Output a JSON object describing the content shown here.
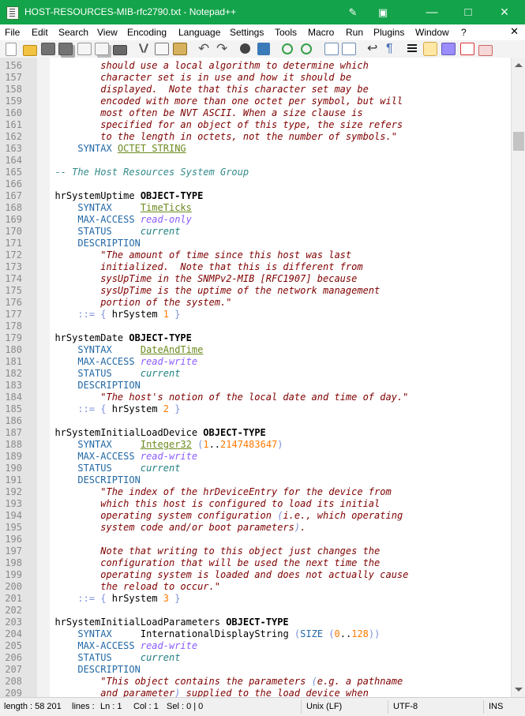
{
  "window": {
    "title": "HOST-RESOURCES-MIB-rfc2790.txt - Notepad++"
  },
  "menu": [
    "File",
    "Edit",
    "Search",
    "View",
    "Encoding",
    "Language",
    "Settings",
    "Tools",
    "Macro",
    "Run",
    "Plugins",
    "Window",
    "?"
  ],
  "toolbar": {
    "icons": [
      "new-file-icon",
      "open-file-icon",
      "save-icon",
      "save-all-icon",
      "close-icon",
      "close-all-icon",
      "print-icon",
      "cut-icon",
      "copy-icon",
      "paste-icon",
      "undo-icon",
      "redo-icon",
      "find-icon",
      "replace-icon",
      "zoom-in-icon",
      "zoom-out-icon",
      "sync-vertical-icon",
      "sync-horizontal-icon",
      "word-wrap-icon",
      "show-symbols-icon",
      "indent-guide-icon",
      "document-map-icon",
      "function-list-icon",
      "folder-as-workspace-icon",
      "monitor-icon",
      "record-macro-icon",
      "play-macro-icon"
    ]
  },
  "editor": {
    "lines": [
      {
        "n": "156",
        "t": "          should use a local algorithm to determine which"
      },
      {
        "n": "157",
        "t": "          character set is in use and how it should be"
      },
      {
        "n": "158",
        "t": "          displayed.  Note that this character set may be"
      },
      {
        "n": "159",
        "t": "          encoded with more than one octet per symbol, but will"
      },
      {
        "n": "160",
        "t": "          most often be NVT ASCII. When a size clause is"
      },
      {
        "n": "161",
        "t": "          specified for an object of this type, the size refers"
      },
      {
        "n": "162",
        "t": "          to the length in octets, not the number of symbols.\""
      },
      {
        "n": "163",
        "t": "      SYNTAX OCTET STRING"
      },
      {
        "n": "164",
        "t": ""
      },
      {
        "n": "165",
        "t": "  -- The Host Resources System Group"
      },
      {
        "n": "166",
        "t": ""
      },
      {
        "n": "167",
        "t": "  hrSystemUptime OBJECT-TYPE"
      },
      {
        "n": "168",
        "t": "      SYNTAX     TimeTicks"
      },
      {
        "n": "169",
        "t": "      MAX-ACCESS read-only"
      },
      {
        "n": "170",
        "t": "      STATUS     current"
      },
      {
        "n": "171",
        "t": "      DESCRIPTION"
      },
      {
        "n": "172",
        "t": "          \"The amount of time since this host was last"
      },
      {
        "n": "173",
        "t": "          initialized.  Note that this is different from"
      },
      {
        "n": "174",
        "t": "          sysUpTime in the SNMPv2-MIB [RFC1907] because"
      },
      {
        "n": "175",
        "t": "          sysUpTime is the uptime of the network management"
      },
      {
        "n": "176",
        "t": "          portion of the system.\""
      },
      {
        "n": "177",
        "t": "      ::= { hrSystem 1 }"
      },
      {
        "n": "178",
        "t": ""
      },
      {
        "n": "179",
        "t": "  hrSystemDate OBJECT-TYPE"
      },
      {
        "n": "180",
        "t": "      SYNTAX     DateAndTime"
      },
      {
        "n": "181",
        "t": "      MAX-ACCESS read-write"
      },
      {
        "n": "182",
        "t": "      STATUS     current"
      },
      {
        "n": "183",
        "t": "      DESCRIPTION"
      },
      {
        "n": "184",
        "t": "          \"The host's notion of the local date and time of day.\""
      },
      {
        "n": "185",
        "t": "      ::= { hrSystem 2 }"
      },
      {
        "n": "186",
        "t": ""
      },
      {
        "n": "187",
        "t": "  hrSystemInitialLoadDevice OBJECT-TYPE"
      },
      {
        "n": "188",
        "t": "      SYNTAX     Integer32 (1..2147483647)"
      },
      {
        "n": "189",
        "t": "      MAX-ACCESS read-write"
      },
      {
        "n": "190",
        "t": "      STATUS     current"
      },
      {
        "n": "191",
        "t": "      DESCRIPTION"
      },
      {
        "n": "192",
        "t": "          \"The index of the hrDeviceEntry for the device from"
      },
      {
        "n": "193",
        "t": "          which this host is configured to load its initial"
      },
      {
        "n": "194",
        "t": "          operating system configuration (i.e., which operating"
      },
      {
        "n": "195",
        "t": "          system code and/or boot parameters)."
      },
      {
        "n": "196",
        "t": ""
      },
      {
        "n": "197",
        "t": "          Note that writing to this object just changes the"
      },
      {
        "n": "198",
        "t": "          configuration that will be used the next time the"
      },
      {
        "n": "199",
        "t": "          operating system is loaded and does not actually cause"
      },
      {
        "n": "200",
        "t": "          the reload to occur.\""
      },
      {
        "n": "201",
        "t": "      ::= { hrSystem 3 }"
      },
      {
        "n": "202",
        "t": ""
      },
      {
        "n": "203",
        "t": "  hrSystemInitialLoadParameters OBJECT-TYPE"
      },
      {
        "n": "204",
        "t": "      SYNTAX     InternationalDisplayString (SIZE (0..128))"
      },
      {
        "n": "205",
        "t": "      MAX-ACCESS read-write"
      },
      {
        "n": "206",
        "t": "      STATUS     current"
      },
      {
        "n": "207",
        "t": "      DESCRIPTION"
      },
      {
        "n": "208",
        "t": "          \"This object contains the parameters (e.g. a pathname"
      },
      {
        "n": "209",
        "t": "          and parameter) supplied to the load device when"
      }
    ]
  },
  "status": {
    "length": "length : 58 201",
    "lines": "lines :",
    "ln": "Ln : 1",
    "col": "Col : 1",
    "sel": "Sel : 0 | 0",
    "eol": "Unix (LF)",
    "encoding": "UTF-8",
    "mode": "INS"
  }
}
